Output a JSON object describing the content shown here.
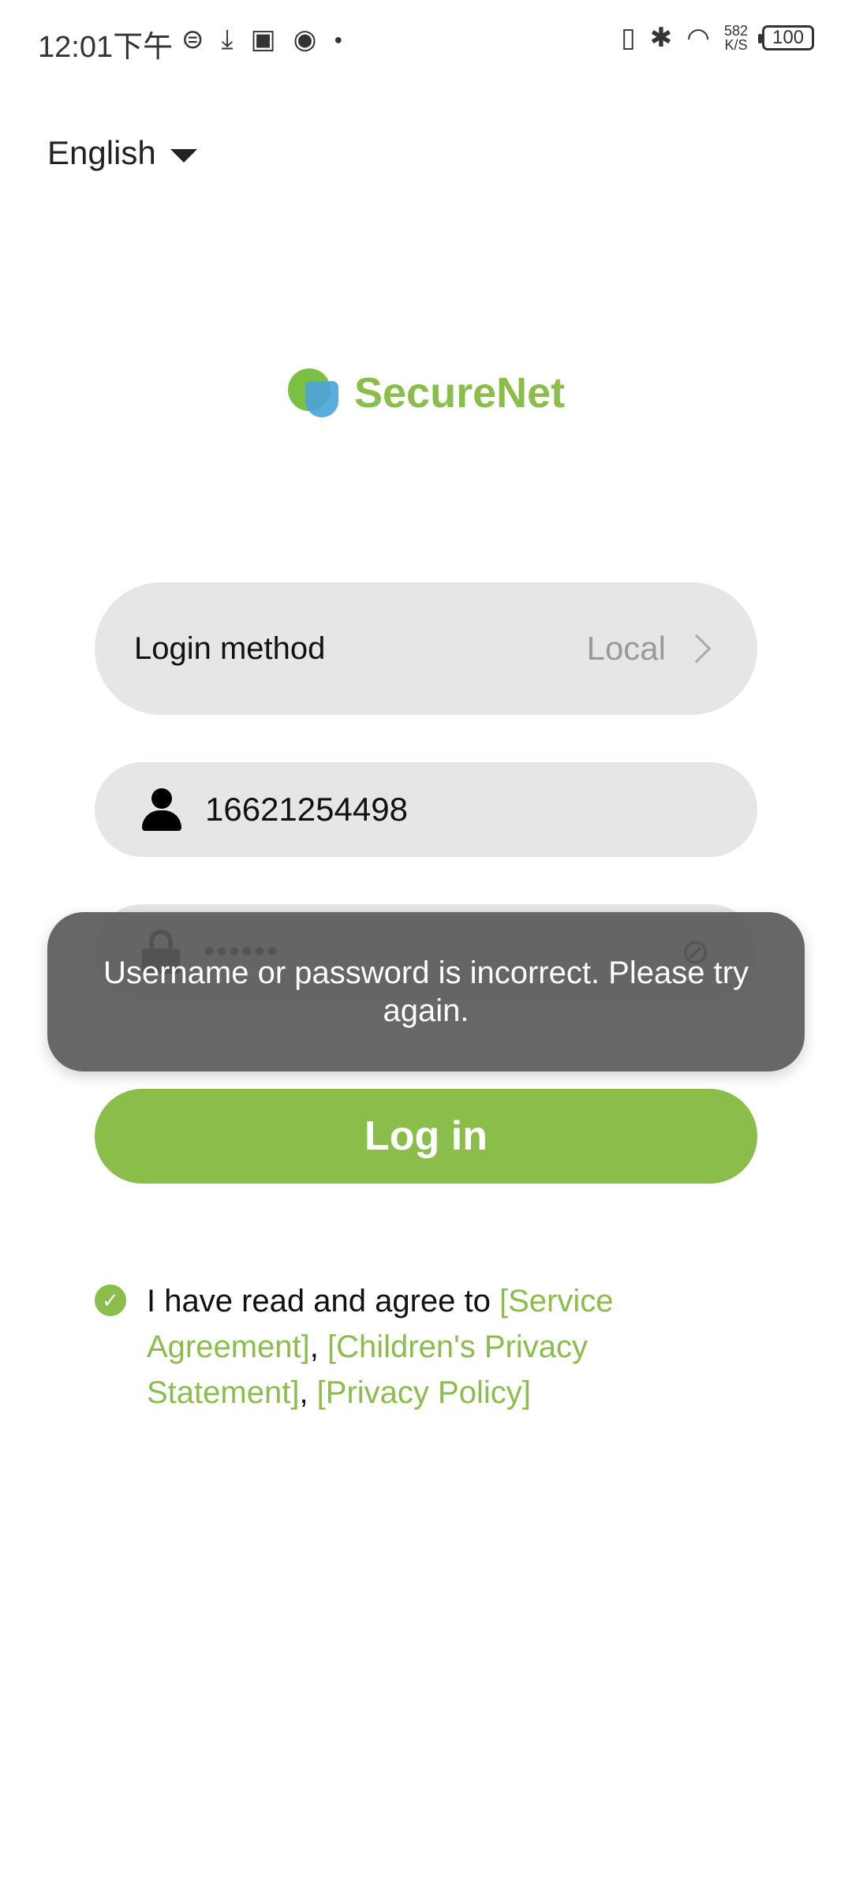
{
  "status_bar": {
    "time": "12:01下午",
    "left_icons": [
      "sim-icon",
      "download-icon",
      "parking-icon",
      "app-icon",
      "dot-icon"
    ],
    "speed_value": "582",
    "speed_unit": "K/S",
    "battery": "100"
  },
  "language": {
    "label": "English"
  },
  "logo": {
    "name": "SecureNet"
  },
  "form": {
    "login_method_label": "Login method",
    "login_method_value": "Local",
    "username": "16621254498",
    "password_mask": "••••••",
    "login_button": "Log in"
  },
  "toast": {
    "message": "Username or password is incorrect. Please try again."
  },
  "agreement": {
    "prefix": "I have read and agree to ",
    "service": "[Service Agreement]",
    "sep1": ", ",
    "children": "[Children's Privacy Statement]",
    "sep2": ", ",
    "privacy": "[Privacy Policy]"
  },
  "colors": {
    "accent": "#8bbd4a",
    "toast_bg": "#5a5a5a",
    "field_bg": "#e6e6e6"
  }
}
